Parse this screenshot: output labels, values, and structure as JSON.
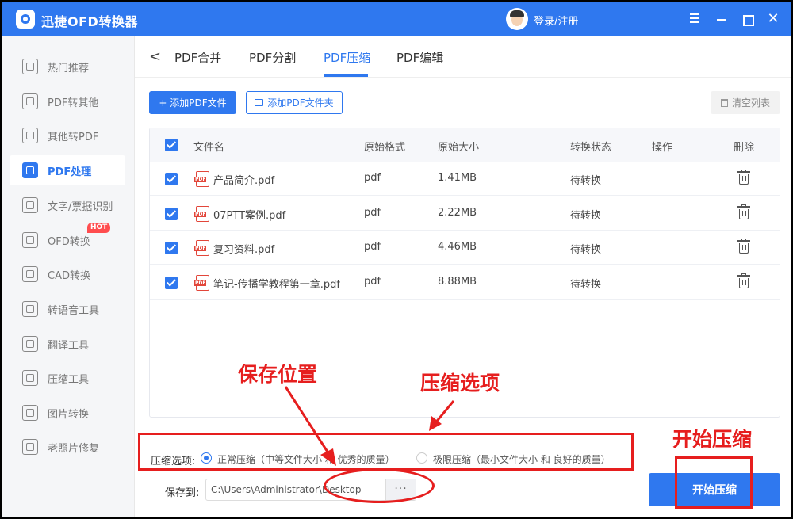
{
  "app": {
    "title": "迅捷OFD转换器",
    "login_label": "登录/注册",
    "window_controls": [
      "menu-icon",
      "minimize-icon",
      "maximize-icon",
      "close-icon"
    ]
  },
  "sidebar": {
    "items": [
      {
        "label": "热门推荐",
        "icon": "star-icon",
        "active": false
      },
      {
        "label": "PDF转其他",
        "icon": "pdf-export-icon",
        "active": false
      },
      {
        "label": "其他转PDF",
        "icon": "pdf-import-icon",
        "active": false
      },
      {
        "label": "PDF处理",
        "icon": "pdf-process-icon",
        "active": true
      },
      {
        "label": "文字/票据识别",
        "icon": "ocr-icon",
        "active": false
      },
      {
        "label": "OFD转换",
        "icon": "ofd-icon",
        "active": false,
        "badge": "HOT"
      },
      {
        "label": "CAD转换",
        "icon": "cad-icon",
        "active": false
      },
      {
        "label": "转语音工具",
        "icon": "voice-icon",
        "active": false
      },
      {
        "label": "翻译工具",
        "icon": "translate-icon",
        "active": false
      },
      {
        "label": "压缩工具",
        "icon": "compress-icon",
        "active": false
      },
      {
        "label": "图片转换",
        "icon": "image-icon",
        "active": false
      },
      {
        "label": "老照片修复",
        "icon": "photo-restore-icon",
        "active": false
      }
    ]
  },
  "tabs": [
    {
      "label": "PDF合并",
      "active": false
    },
    {
      "label": "PDF分割",
      "active": false
    },
    {
      "label": "PDF压缩",
      "active": true
    },
    {
      "label": "PDF编辑",
      "active": false
    }
  ],
  "toolbar": {
    "add_file_label": "+ 添加PDF文件",
    "add_folder_label": "添加PDF文件夹",
    "clear_label": "清空列表"
  },
  "table": {
    "headers": [
      "文件名",
      "原始格式",
      "原始大小",
      "转换状态",
      "操作",
      "删除"
    ],
    "rows": [
      {
        "name": "产品简介.pdf",
        "format": "pdf",
        "size": "1.41MB",
        "status": "待转换",
        "checked": true
      },
      {
        "name": "07PTT案例.pdf",
        "format": "pdf",
        "size": "2.22MB",
        "status": "待转换",
        "checked": true
      },
      {
        "name": "复习资料.pdf",
        "format": "pdf",
        "size": "4.46MB",
        "status": "待转换",
        "checked": true
      },
      {
        "name": "笔记-传播学教程第一章.pdf",
        "format": "pdf",
        "size": "8.88MB",
        "status": "待转换",
        "checked": true
      }
    ]
  },
  "bottom": {
    "compress_label": "压缩选项:",
    "option_normal": "正常压缩（中等文件大小 和 优秀的质量）",
    "option_extreme": "极限压缩（最小文件大小 和 良好的质量）",
    "selected_option": "normal",
    "save_label": "保存到:",
    "save_path": "C:\\Users\\Administrator\\Desktop",
    "browse_label": "···",
    "start_label": "开始压缩"
  },
  "annotations": {
    "save_location": "保存位置",
    "compress_options": "压缩选项",
    "start_compress": "开始压缩",
    "color": "#e61e1e"
  },
  "colors": {
    "accent": "#2f78ef",
    "badge": "#ff4d4f"
  }
}
